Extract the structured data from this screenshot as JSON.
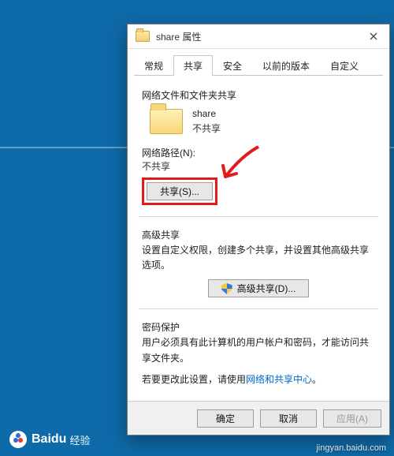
{
  "window": {
    "title": "share 属性"
  },
  "tabs": {
    "general": "常规",
    "sharing": "共享",
    "security": "安全",
    "previous": "以前的版本",
    "custom": "自定义"
  },
  "section1": {
    "heading": "网络文件和文件夹共享",
    "name": "share",
    "status": "不共享",
    "pathLabel": "网络路径(N):",
    "pathValue": "不共享",
    "shareBtn": "共享(S)..."
  },
  "section2": {
    "heading": "高级共享",
    "desc": "设置自定义权限，创建多个共享，并设置其他高级共享选项。",
    "btn": "高级共享(D)..."
  },
  "section3": {
    "heading": "密码保护",
    "p1": "用户必须具有此计算机的用户帐户和密码，才能访问共享文件夹。",
    "p2a": "若要更改此设置，请使用",
    "link": "网络和共享中心",
    "p2b": "。"
  },
  "footer": {
    "ok": "确定",
    "cancel": "取消",
    "apply": "应用(A)"
  },
  "brand": {
    "name": "Baidu",
    "sub": "经验",
    "url": "jingyan.baidu.com"
  }
}
